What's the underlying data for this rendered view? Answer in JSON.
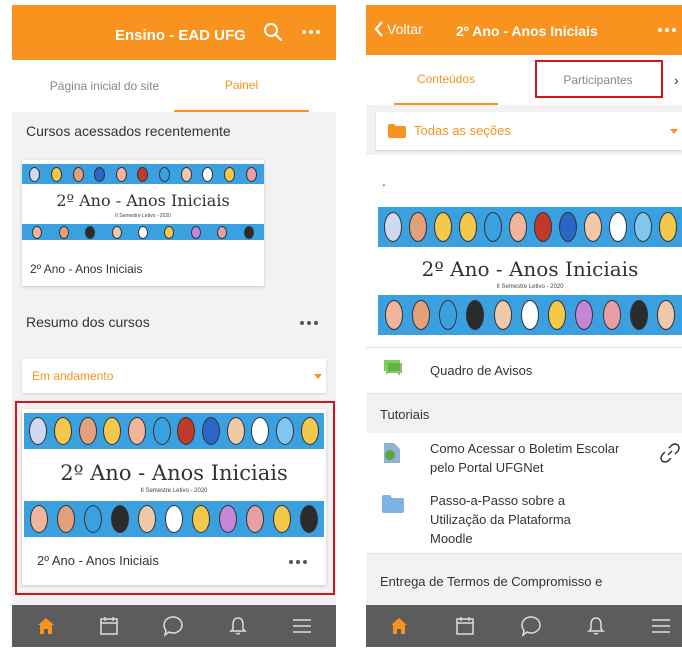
{
  "left": {
    "header": {
      "title": "Ensino - EAD UFG"
    },
    "tabs": [
      {
        "label": "Página inicial do site"
      },
      {
        "label": "Painel"
      }
    ],
    "recent": {
      "heading": "Cursos acessados recentemente",
      "course": {
        "banner_title": "2º Ano - Anos Iniciais",
        "banner_sub": "II Semestre Letivo - 2020",
        "name": "2º Ano - Anos Iniciais"
      }
    },
    "summary": {
      "heading": "Resumo dos cursos",
      "filter_value": "Em andamento",
      "course": {
        "banner_title": "2º Ano - Anos Iniciais",
        "banner_sub": "II Semestre Letivo - 2020",
        "name": "2º Ano - Anos Iniciais"
      }
    },
    "bottom_nav": [
      "home-icon",
      "calendar-icon",
      "chat-icon",
      "bell-icon",
      "menu-icon"
    ]
  },
  "right": {
    "header": {
      "back_label": "Voltar",
      "title": "2º Ano - Anos Iniciais"
    },
    "tabs": [
      {
        "label": "Conteúdos"
      },
      {
        "label": "Participantes"
      }
    ],
    "sections_dropdown": "Todas as seções",
    "dot_line": ".",
    "banner": {
      "title": "2º Ano - Anos Iniciais",
      "sub": "II Semestre Letivo - 2020"
    },
    "forum": {
      "label": "Quadro de Avisos"
    },
    "section_tutoriais": "Tutoriais",
    "items": [
      {
        "label": "Como Acessar o Boletim Escolar pelo Portal UFGNet"
      },
      {
        "label": "Passo-a-Passo sobre a Utilização da Plataforma Moodle"
      }
    ],
    "section_entrega": "Entrega de Termos de Compromisso e Responsabilidade",
    "bottom_nav": [
      "home-icon",
      "calendar-icon",
      "chat-icon",
      "bell-icon",
      "menu-icon"
    ]
  },
  "colors": {
    "accent": "#f7931e",
    "highlight": "#d8131f",
    "banner_blue": "#3aa0e0",
    "bar": "#5c5c5c"
  }
}
